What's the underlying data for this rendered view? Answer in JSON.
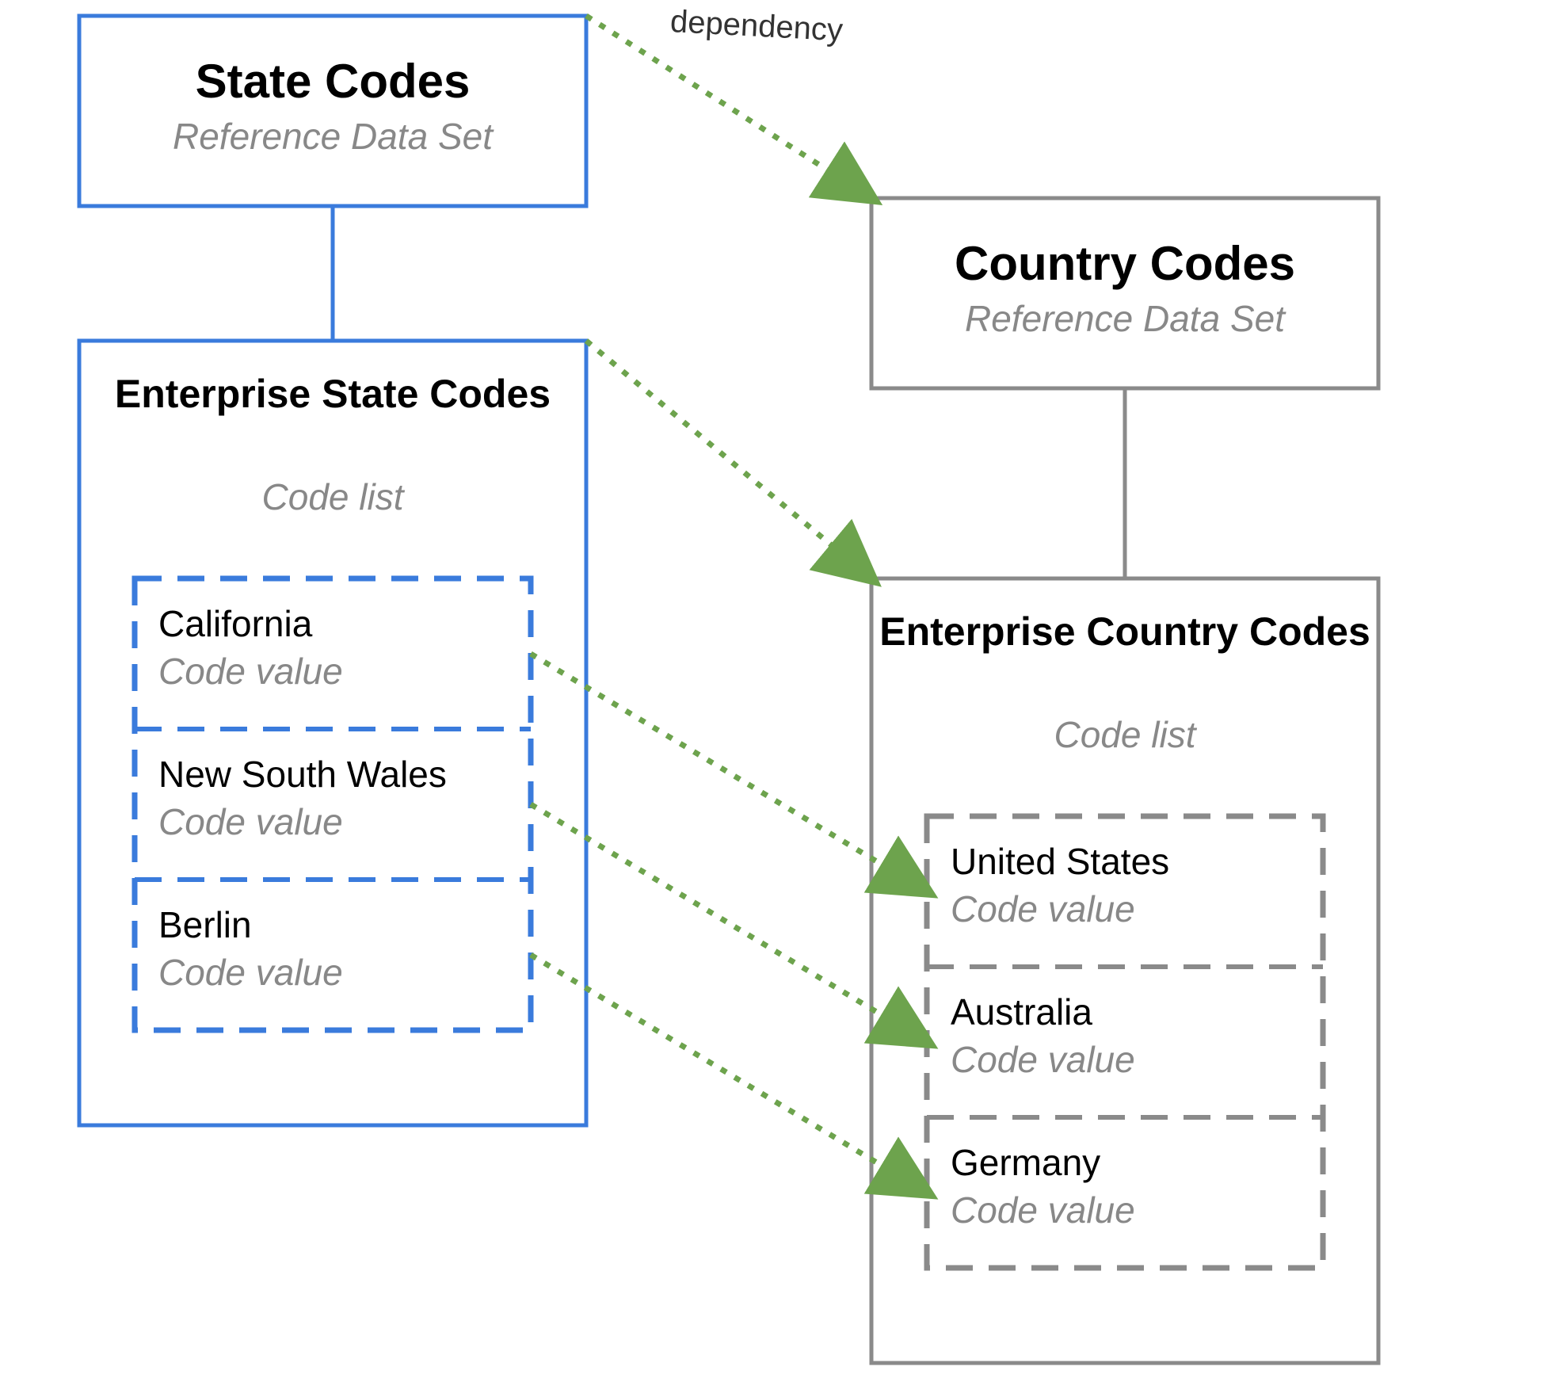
{
  "colors": {
    "blue": "#3A7BDC",
    "gray": "#8A8A8A",
    "green": "#6DA34D"
  },
  "labels": {
    "dependency": "dependency",
    "ref_data_set": "Reference Data Set",
    "code_list": "Code list",
    "code_value": "Code value"
  },
  "state": {
    "title": "State Codes",
    "enterprise_title": "Enterprise State Codes",
    "values": [
      {
        "name": "California"
      },
      {
        "name": "New South Wales"
      },
      {
        "name": "Berlin"
      }
    ]
  },
  "country": {
    "title": "Country Codes",
    "enterprise_title": "Enterprise Country Codes",
    "values": [
      {
        "name": "United States"
      },
      {
        "name": "Australia"
      },
      {
        "name": "Germany"
      }
    ]
  }
}
